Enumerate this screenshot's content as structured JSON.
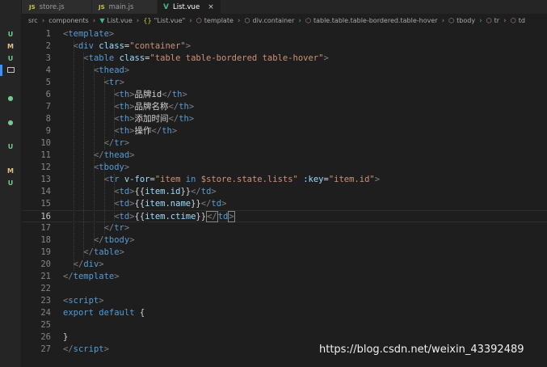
{
  "tabs": [
    {
      "icon": "JS",
      "label": "store.js",
      "active": false
    },
    {
      "icon": "JS",
      "label": "main.js",
      "active": false
    },
    {
      "icon": "V",
      "label": "List.vue",
      "active": true,
      "close": "×"
    }
  ],
  "breadcrumb": [
    "src",
    "components",
    "List.vue",
    "\"List.vue\"",
    "template",
    "div.container",
    "table.table.table-bordered.table-hover",
    "tbody",
    "tr",
    "td"
  ],
  "breadcrumb_braces": "{}",
  "scm_markers": [
    {
      "text": "U",
      "color": "#73c991"
    },
    {
      "text": "M",
      "color": "#e2c08d"
    },
    {
      "text": "U",
      "color": "#73c991"
    },
    {
      "text": "●",
      "color": "#73c991"
    },
    {
      "text": "●",
      "color": "#73c991"
    },
    {
      "text": "U",
      "color": "#73c991"
    },
    {
      "text": "M",
      "color": "#e2c08d"
    },
    {
      "text": "U",
      "color": "#73c991"
    }
  ],
  "current_line": 16,
  "code_lines": [
    [
      [
        "p",
        "<"
      ],
      [
        "t",
        "template"
      ],
      [
        "p",
        ">"
      ]
    ],
    [
      [
        "x",
        "  "
      ],
      [
        "p",
        "<"
      ],
      [
        "t",
        "div"
      ],
      [
        "x",
        " "
      ],
      [
        "a",
        "class"
      ],
      [
        "x",
        "="
      ],
      [
        "s",
        "\"container\""
      ],
      [
        "p",
        ">"
      ]
    ],
    [
      [
        "x",
        "    "
      ],
      [
        "p",
        "<"
      ],
      [
        "t",
        "table"
      ],
      [
        "x",
        " "
      ],
      [
        "a",
        "class"
      ],
      [
        "x",
        "="
      ],
      [
        "s",
        "\"table table-bordered table-hover\""
      ],
      [
        "p",
        ">"
      ]
    ],
    [
      [
        "x",
        "      "
      ],
      [
        "p",
        "<"
      ],
      [
        "t",
        "thead"
      ],
      [
        "p",
        ">"
      ]
    ],
    [
      [
        "x",
        "        "
      ],
      [
        "p",
        "<"
      ],
      [
        "t",
        "tr"
      ],
      [
        "p",
        ">"
      ]
    ],
    [
      [
        "x",
        "          "
      ],
      [
        "p",
        "<"
      ],
      [
        "t",
        "th"
      ],
      [
        "p",
        ">"
      ],
      [
        "x",
        "品牌id"
      ],
      [
        "p",
        "</"
      ],
      [
        "t",
        "th"
      ],
      [
        "p",
        ">"
      ]
    ],
    [
      [
        "x",
        "          "
      ],
      [
        "p",
        "<"
      ],
      [
        "t",
        "th"
      ],
      [
        "p",
        ">"
      ],
      [
        "x",
        "品牌名称"
      ],
      [
        "p",
        "</"
      ],
      [
        "t",
        "th"
      ],
      [
        "p",
        ">"
      ]
    ],
    [
      [
        "x",
        "          "
      ],
      [
        "p",
        "<"
      ],
      [
        "t",
        "th"
      ],
      [
        "p",
        ">"
      ],
      [
        "x",
        "添加时间"
      ],
      [
        "p",
        "</"
      ],
      [
        "t",
        "th"
      ],
      [
        "p",
        ">"
      ]
    ],
    [
      [
        "x",
        "          "
      ],
      [
        "p",
        "<"
      ],
      [
        "t",
        "th"
      ],
      [
        "p",
        ">"
      ],
      [
        "x",
        "操作"
      ],
      [
        "p",
        "</"
      ],
      [
        "t",
        "th"
      ],
      [
        "p",
        ">"
      ]
    ],
    [
      [
        "x",
        "        "
      ],
      [
        "p",
        "</"
      ],
      [
        "t",
        "tr"
      ],
      [
        "p",
        ">"
      ]
    ],
    [
      [
        "x",
        "      "
      ],
      [
        "p",
        "</"
      ],
      [
        "t",
        "thead"
      ],
      [
        "p",
        ">"
      ]
    ],
    [
      [
        "x",
        "      "
      ],
      [
        "p",
        "<"
      ],
      [
        "t",
        "tbody"
      ],
      [
        "p",
        ">"
      ]
    ],
    [
      [
        "x",
        "        "
      ],
      [
        "p",
        "<"
      ],
      [
        "t",
        "tr"
      ],
      [
        "x",
        " "
      ],
      [
        "a",
        "v-for"
      ],
      [
        "x",
        "="
      ],
      [
        "s",
        "\"item "
      ],
      [
        "k",
        "in"
      ],
      [
        "s",
        " $store.state.lists\""
      ],
      [
        "x",
        " "
      ],
      [
        "a",
        ":key"
      ],
      [
        "x",
        "="
      ],
      [
        "s",
        "\"item.id\""
      ],
      [
        "p",
        ">"
      ]
    ],
    [
      [
        "x",
        "          "
      ],
      [
        "p",
        "<"
      ],
      [
        "t",
        "td"
      ],
      [
        "p",
        ">"
      ],
      [
        "x",
        "{{"
      ],
      [
        "a",
        "item.id"
      ],
      [
        "x",
        "}}"
      ],
      [
        "p",
        "</"
      ],
      [
        "t",
        "td"
      ],
      [
        "p",
        ">"
      ]
    ],
    [
      [
        "x",
        "          "
      ],
      [
        "p",
        "<"
      ],
      [
        "t",
        "td"
      ],
      [
        "p",
        ">"
      ],
      [
        "x",
        "{{"
      ],
      [
        "a",
        "item.name"
      ],
      [
        "x",
        "}}"
      ],
      [
        "p",
        "</"
      ],
      [
        "t",
        "td"
      ],
      [
        "p",
        ">"
      ]
    ],
    [
      [
        "x",
        "          "
      ],
      [
        "p",
        "<"
      ],
      [
        "t",
        "td"
      ],
      [
        "p",
        ">"
      ],
      [
        "x",
        "{{"
      ],
      [
        "a",
        "item.ctime"
      ],
      [
        "x",
        "}}"
      ],
      [
        "ma",
        "</"
      ],
      [
        "t",
        "td"
      ],
      [
        "ma",
        ">"
      ]
    ],
    [
      [
        "x",
        "        "
      ],
      [
        "p",
        "</"
      ],
      [
        "t",
        "tr"
      ],
      [
        "p",
        ">"
      ]
    ],
    [
      [
        "x",
        "      "
      ],
      [
        "p",
        "</"
      ],
      [
        "t",
        "tbody"
      ],
      [
        "p",
        ">"
      ]
    ],
    [
      [
        "x",
        "    "
      ],
      [
        "p",
        "</"
      ],
      [
        "t",
        "table"
      ],
      [
        "p",
        ">"
      ]
    ],
    [
      [
        "x",
        "  "
      ],
      [
        "p",
        "</"
      ],
      [
        "t",
        "div"
      ],
      [
        "p",
        ">"
      ]
    ],
    [
      [
        "p",
        "</"
      ],
      [
        "t",
        "template"
      ],
      [
        "p",
        ">"
      ]
    ],
    [],
    [
      [
        "p",
        "<"
      ],
      [
        "t",
        "script"
      ],
      [
        "p",
        ">"
      ]
    ],
    [
      [
        "k",
        "export"
      ],
      [
        "x",
        " "
      ],
      [
        "k",
        "default"
      ],
      [
        "x",
        " {"
      ]
    ],
    [],
    [
      [
        "x",
        "}"
      ]
    ],
    [
      [
        "p",
        "</"
      ],
      [
        "t",
        "script"
      ],
      [
        "p",
        ">"
      ]
    ]
  ],
  "watermark": "https://blog.csdn.net/weixin_43392489"
}
